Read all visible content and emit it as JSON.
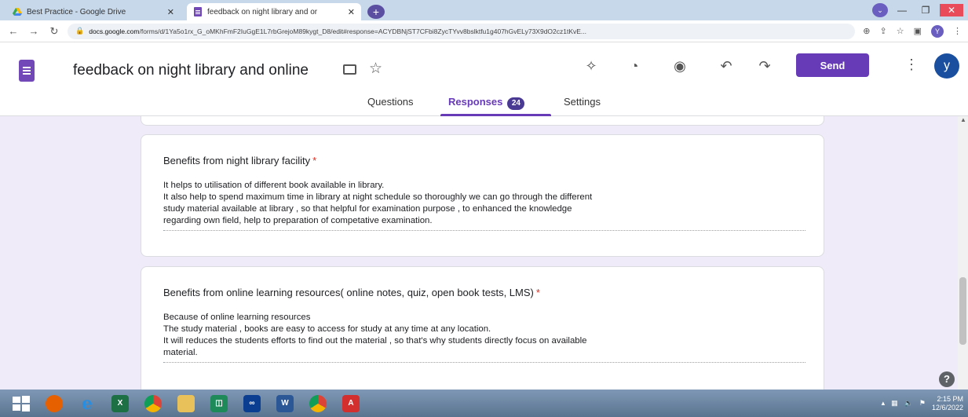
{
  "browser": {
    "tabs": [
      {
        "title": "Best Practice - Google Drive",
        "close": "✕"
      },
      {
        "title": "feedback on night library and or",
        "close": "✕"
      }
    ],
    "new_tab": "+",
    "url_domain": "docs.google.com",
    "url_path": "/forms/d/1Ya5o1rx_G_oMKhFmF2IuGgE1L7rbGrejoM89kygt_D8/edit#response=ACYDBNjST7CFbi8ZycTYvv8bslktfu1g407hGvELy73X9dO2cz1tKvE...",
    "profile_initial": "Y"
  },
  "header": {
    "title": "feedback on night library and online",
    "send_label": "Send",
    "avatar_initial": "y",
    "kebab": "⋮"
  },
  "tabs": {
    "questions": "Questions",
    "responses": "Responses",
    "responses_count": "24",
    "settings": "Settings"
  },
  "questions": [
    {
      "title": "Benefits from night library  facility",
      "required_mark": "*",
      "answer_lines": [
        "It helps to utilisation of different book available in library.",
        "It also help to spend maximum time in library at night schedule so thoroughly we can go through the different",
        "study material available at library  , so that helpful for examination purpose , to enhanced the knowledge",
        "regarding own field, help to preparation of competative examination."
      ]
    },
    {
      "title": "Benefits from online learning resources( online notes, quiz, open book tests, LMS)",
      "required_mark": "*",
      "answer_lines": [
        "Because of online learning resources",
        "The study material , books are easy to access for study at any time  at any location.",
        "It will reduces the students efforts to find out the material , so that's why students directly focus on available",
        "material."
      ]
    }
  ],
  "help": "?",
  "taskbar": {
    "time": "2:15 PM",
    "date": "12/6/2022"
  }
}
